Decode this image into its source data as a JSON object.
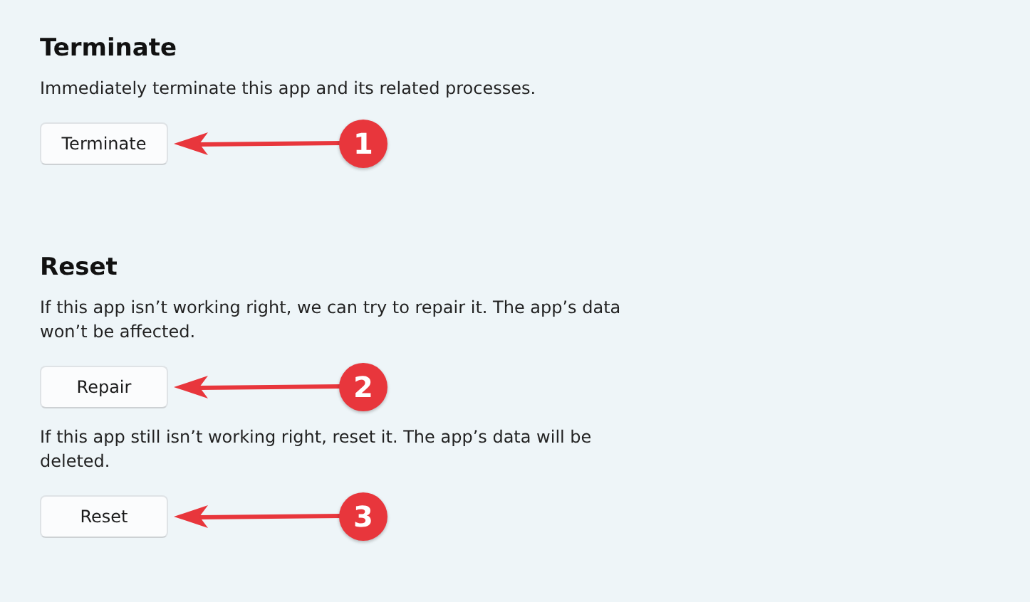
{
  "sections": [
    {
      "title": "Terminate",
      "items": [
        {
          "kind": "text",
          "text": "Immediately terminate this app and its related processes."
        },
        {
          "kind": "button",
          "label": "Terminate",
          "callout": "1"
        }
      ]
    },
    {
      "title": "Reset",
      "items": [
        {
          "kind": "text",
          "text": "If this app isn’t working right, we can try to repair it. The app’s data won’t be affected."
        },
        {
          "kind": "button",
          "label": "Repair",
          "callout": "2"
        },
        {
          "kind": "text",
          "text": "If this app still isn’t working right, reset it. The app’s data will be deleted."
        },
        {
          "kind": "button",
          "label": "Reset",
          "callout": "3"
        }
      ]
    }
  ]
}
